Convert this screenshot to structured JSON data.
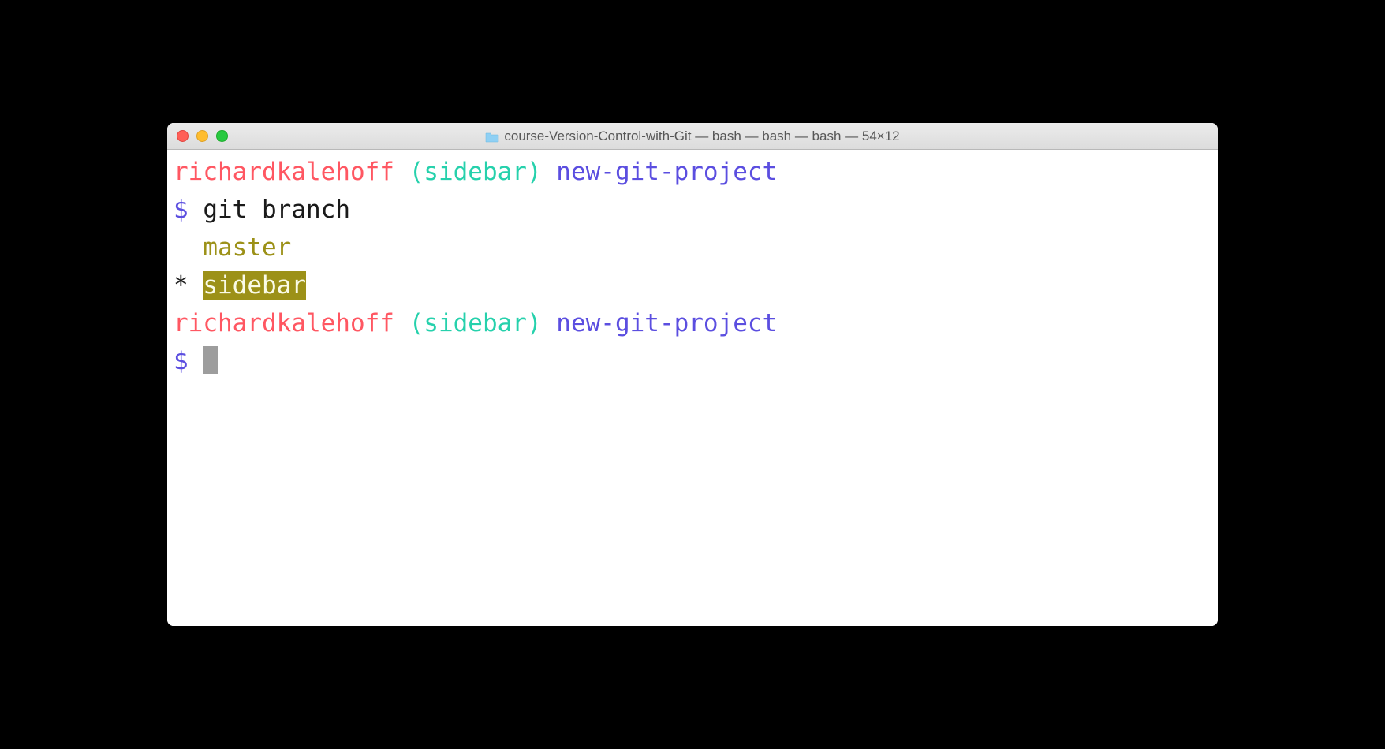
{
  "window": {
    "title": "course-Version-Control-with-Git — bash — bash — bash — 54×12"
  },
  "terminal": {
    "prompt1": {
      "user": "richardkalehoff",
      "branch": "(sidebar)",
      "project": "new-git-project",
      "dollar": "$",
      "command": "git branch"
    },
    "output": {
      "other_branch": "master",
      "current_marker": "*",
      "current_branch": "sidebar"
    },
    "prompt2": {
      "user": "richardkalehoff",
      "branch": "(sidebar)",
      "project": "new-git-project",
      "dollar": "$"
    }
  }
}
